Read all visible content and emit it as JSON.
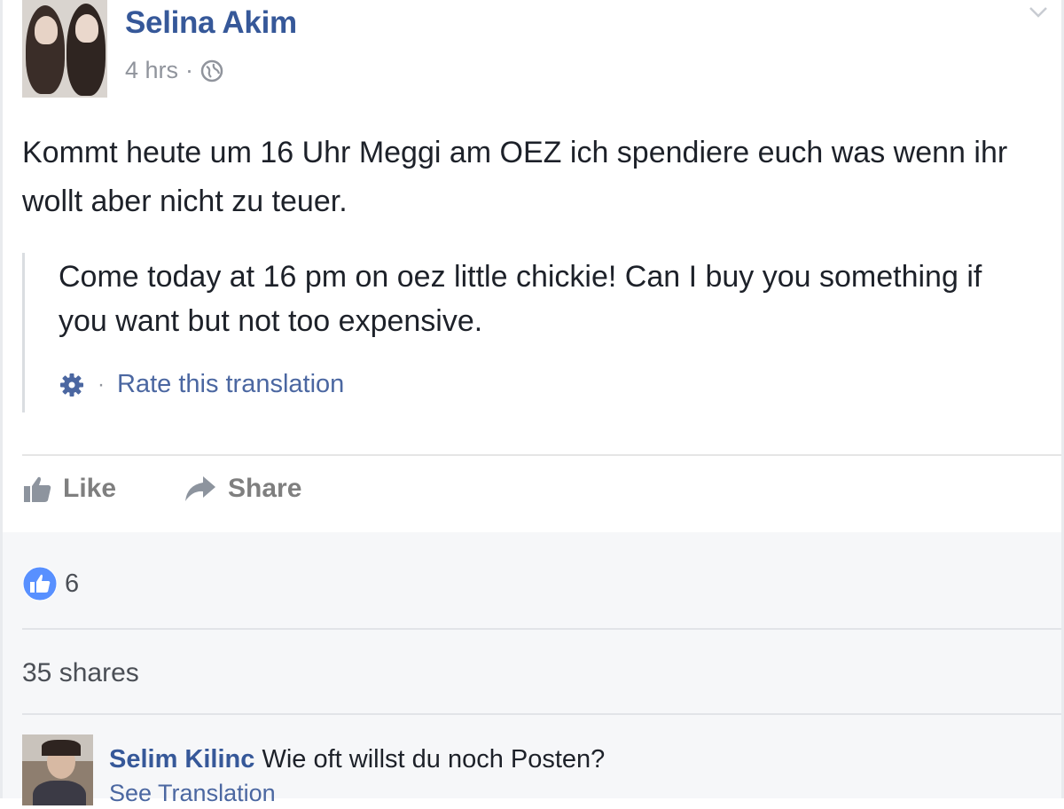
{
  "post": {
    "author": "Selina Akim",
    "timestamp": "4 hrs",
    "meta_separator": "·",
    "text": "Kommt heute um 16 Uhr Meggi am OEZ ich spendiere euch was wenn ihr wollt aber nicht zu teuer.",
    "translation": "Come today at 16 pm on oez little chickie! Can I buy you something if you want but not too expensive.",
    "rate_separator": "·",
    "rate_translation_label": "Rate this translation"
  },
  "actions": {
    "like_label": "Like",
    "share_label": "Share"
  },
  "engagement": {
    "reaction_count": "6",
    "shares_label": "35 shares"
  },
  "comment": {
    "author": "Selim Kilinc",
    "text": "Wie oft willst du noch Posten?",
    "see_translation_label": "See Translation"
  },
  "colors": {
    "link_blue": "#365899",
    "like_blue": "#5890ff",
    "secondary_text": "#90949c"
  },
  "icons": [
    "globe-icon",
    "chevron-down-icon",
    "gear-icon",
    "like-icon",
    "share-icon",
    "reaction-like-icon"
  ]
}
